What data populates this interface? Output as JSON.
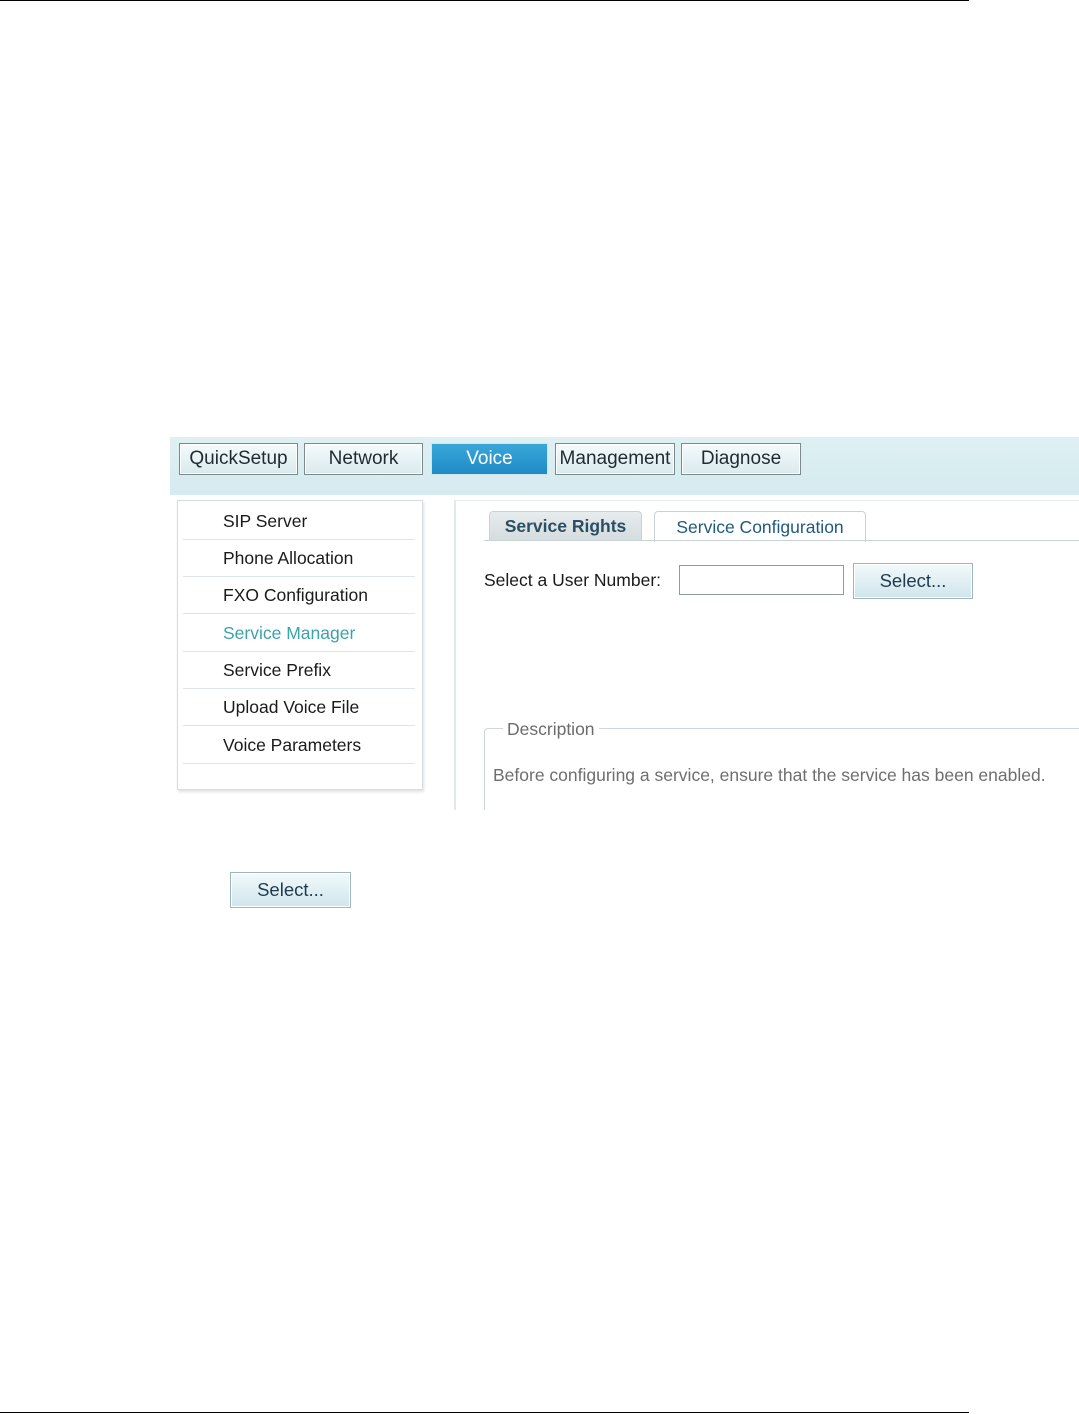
{
  "nav": {
    "tabs": [
      {
        "label": "QuickSetup",
        "active": false
      },
      {
        "label": "Network",
        "active": false
      },
      {
        "label": "Voice",
        "active": true
      },
      {
        "label": "Management",
        "active": false
      },
      {
        "label": "Diagnose",
        "active": false
      }
    ],
    "active_color": "#2196cf"
  },
  "sidebar": {
    "items": [
      {
        "label": "SIP Server"
      },
      {
        "label": "Phone Allocation"
      },
      {
        "label": "FXO Configuration"
      },
      {
        "label": "Service Manager",
        "active": true
      },
      {
        "label": "Service Prefix"
      },
      {
        "label": "Upload Voice File"
      },
      {
        "label": "Voice Parameters"
      }
    ],
    "active_color": "#3aa3a8"
  },
  "main": {
    "subtabs": [
      {
        "label": "Service Rights",
        "selected": false
      },
      {
        "label": "Service Configuration",
        "selected": true
      }
    ],
    "user_number_label": "Select a User Number:",
    "user_number_value": "",
    "select_button_label": "Select...",
    "description": {
      "legend": "Description",
      "text": "Before configuring a service, ensure that the service has been enabled."
    }
  },
  "standalone_button": {
    "label": "Select..."
  }
}
